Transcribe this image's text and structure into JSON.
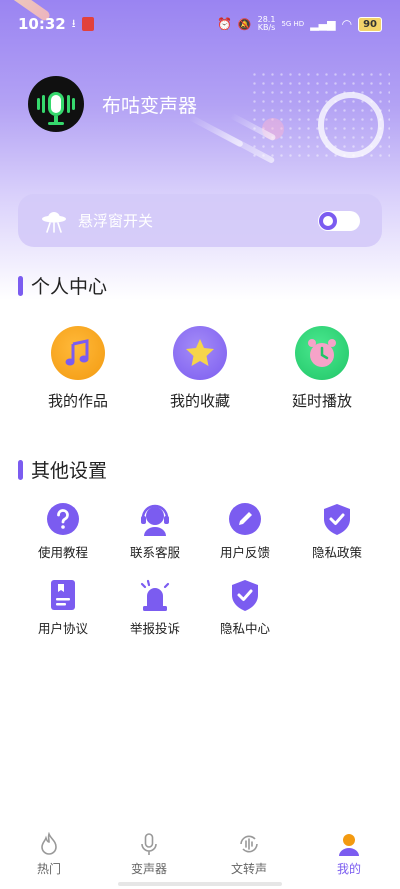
{
  "status_bar": {
    "time": "10:32",
    "net_speed_top": "28.1",
    "net_speed_bottom": "KB/s",
    "network": "5G HD",
    "battery": "90"
  },
  "profile": {
    "app_name": "布咕变声器",
    "avatar_icon": "microphone-icon"
  },
  "floating_window": {
    "label": "悬浮窗开关",
    "icon": "ufo-icon",
    "toggle_on": false
  },
  "personal_center": {
    "title": "个人中心",
    "items": [
      {
        "label": "我的作品",
        "icon": "music-note-icon",
        "color": "#f7a21b"
      },
      {
        "label": "我的收藏",
        "icon": "star-icon",
        "color": "#8f6cf2"
      },
      {
        "label": "延时播放",
        "icon": "alarm-clock-icon",
        "color": "#37d17a"
      }
    ]
  },
  "other_settings": {
    "title": "其他设置",
    "items": [
      {
        "label": "使用教程",
        "icon": "question-icon"
      },
      {
        "label": "联系客服",
        "icon": "headset-icon"
      },
      {
        "label": "用户反馈",
        "icon": "pencil-icon"
      },
      {
        "label": "隐私政策",
        "icon": "shield-check-icon"
      },
      {
        "label": "用户协议",
        "icon": "document-icon"
      },
      {
        "label": "举报投诉",
        "icon": "alarm-light-icon"
      },
      {
        "label": "隐私中心",
        "icon": "shield-check-icon"
      }
    ]
  },
  "tabbar": {
    "tabs": [
      {
        "label": "热门",
        "icon": "flame-icon",
        "active": false
      },
      {
        "label": "变声器",
        "icon": "microphone-icon",
        "active": false
      },
      {
        "label": "文转声",
        "icon": "text-to-speech-icon",
        "active": false
      },
      {
        "label": "我的",
        "icon": "person-icon",
        "active": true
      }
    ]
  },
  "colors": {
    "accent": "#7b5cf0",
    "header_gradient_top": "#9a84f2"
  }
}
